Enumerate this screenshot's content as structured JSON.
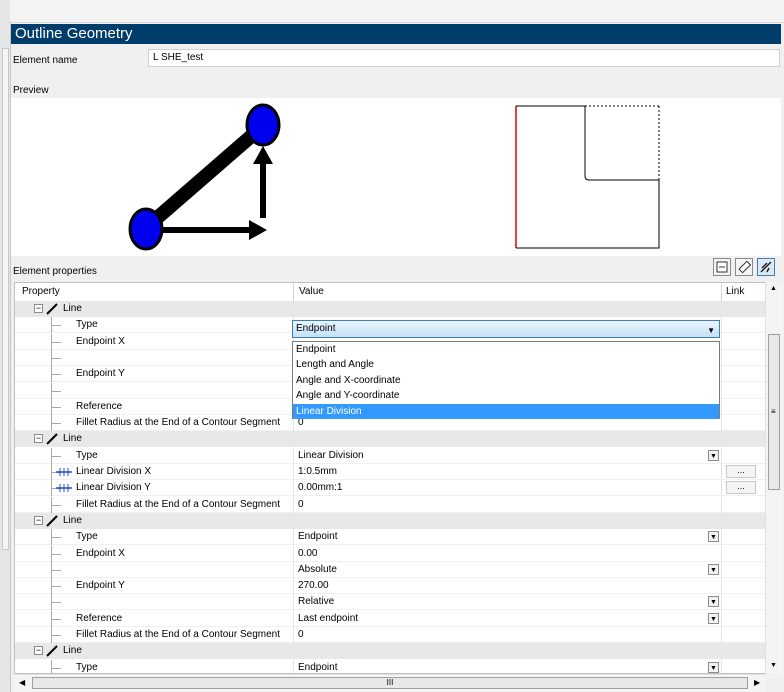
{
  "panel": {
    "title": "Outline Geometry",
    "element_name_label": "Element name",
    "element_name_value": "L SHE_test",
    "preview_label": "Preview",
    "element_properties_label": "Element properties"
  },
  "toolbar": {
    "collapse_icon": "collapse-icon",
    "measure_icon": "ruler-icon",
    "edit_icon": "geometry-edit-icon"
  },
  "grid": {
    "headers": {
      "property": "Property",
      "value": "Value",
      "link": "Link"
    },
    "open_dropdown": {
      "selected": "Endpoint",
      "options": [
        "Endpoint",
        "Length and Angle",
        "Angle and X-coordinate",
        "Angle and Y-coordinate",
        "Linear Division"
      ],
      "highlighted": "Linear Division"
    },
    "rows": [
      {
        "kind": "group",
        "label": "Line"
      },
      {
        "kind": "prop",
        "label": "Type",
        "value": ""
      },
      {
        "kind": "prop",
        "label": "Endpoint X",
        "value": ""
      },
      {
        "kind": "prop",
        "label": "",
        "value": ""
      },
      {
        "kind": "prop",
        "label": "Endpoint Y",
        "value": ""
      },
      {
        "kind": "prop",
        "label": "",
        "value": ""
      },
      {
        "kind": "prop",
        "label": "Reference",
        "value": ""
      },
      {
        "kind": "prop",
        "label": "Fillet Radius at the End of a Contour Segment",
        "value": "0"
      },
      {
        "kind": "group",
        "label": "Line"
      },
      {
        "kind": "prop",
        "label": "Type",
        "value": "Linear Division",
        "dropdown": true
      },
      {
        "kind": "prop",
        "label": "Linear Division X",
        "value": "1:0.5mm",
        "link": "...",
        "icon": "linear-division-icon"
      },
      {
        "kind": "prop",
        "label": "Linear Division Y",
        "value": "0.00mm:1",
        "link": "...",
        "icon": "linear-division-icon"
      },
      {
        "kind": "prop",
        "label": "Fillet Radius at the End of a Contour Segment",
        "value": "0"
      },
      {
        "kind": "group",
        "label": "Line"
      },
      {
        "kind": "prop",
        "label": "Type",
        "value": "Endpoint",
        "dropdown": true
      },
      {
        "kind": "prop",
        "label": "Endpoint X",
        "value": "0.00"
      },
      {
        "kind": "prop",
        "label": "",
        "value": "Absolute",
        "dropdown": true
      },
      {
        "kind": "prop",
        "label": "Endpoint Y",
        "value": "270.00"
      },
      {
        "kind": "prop",
        "label": "",
        "value": "Relative",
        "dropdown": true
      },
      {
        "kind": "prop",
        "label": "Reference",
        "value": "Last endpoint",
        "dropdown": true
      },
      {
        "kind": "prop",
        "label": "Fillet Radius at the End of a Contour Segment",
        "value": "0"
      },
      {
        "kind": "group",
        "label": "Line"
      },
      {
        "kind": "prop",
        "label": "Type",
        "value": "Endpoint",
        "dropdown": true
      }
    ]
  },
  "scroll": {
    "h_thumb_glyph": "III",
    "v_thumb_glyph": "≡"
  },
  "colors": {
    "title_bg": "#003d6b",
    "highlight": "#3399ff",
    "preview_red": "#e00000",
    "point_blue": "#0000ee"
  }
}
